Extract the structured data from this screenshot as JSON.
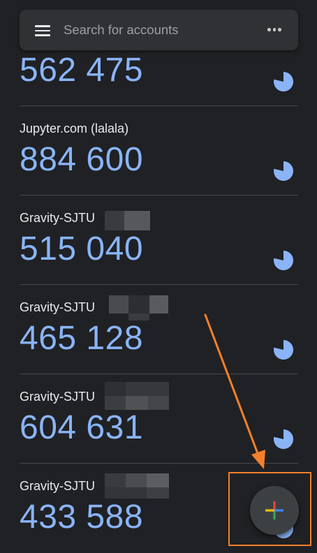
{
  "search": {
    "placeholder": "Search for accounts",
    "menu_icon": "hamburger-menu-icon",
    "more_icon": "more-horizontal-icon"
  },
  "accounts": [
    {
      "label": "",
      "code": "562 475"
    },
    {
      "label": "Jupyter.com (lalala)",
      "code": "884 600"
    },
    {
      "label": "Gravity-SJTU",
      "code": "515 040"
    },
    {
      "label": "Gravity-SJTU",
      "code": "465 128"
    },
    {
      "label": "Gravity-SJTU",
      "code": "604 631"
    },
    {
      "label": "Gravity-SJTU",
      "code": "433 588"
    }
  ],
  "fab": {
    "icon": "plus-add-icon"
  },
  "annotation": {
    "color": "#f3802b"
  },
  "colors": {
    "background": "#202124",
    "code": "#8ab4f8",
    "timer": "#8ab4f8"
  }
}
